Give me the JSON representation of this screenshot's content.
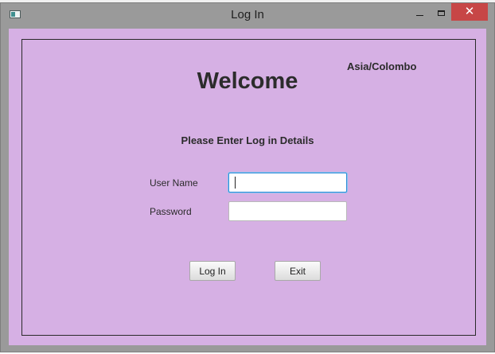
{
  "window": {
    "title": "Log In",
    "close_glyph": "✕",
    "icons": [
      "app-icon",
      "minimize-icon",
      "maximize-icon",
      "close-icon"
    ]
  },
  "form": {
    "timezone": "Asia/Colombo",
    "welcome": "Welcome",
    "subtitle": "Please Enter Log in Details",
    "username_label": "User Name",
    "username_value": "",
    "password_label": "Password",
    "password_value": "",
    "login_button": "Log In",
    "exit_button": "Exit"
  },
  "colors": {
    "background": "#d6b0e4",
    "close_button": "#c74646",
    "focus_border": "#2f8ad8"
  }
}
